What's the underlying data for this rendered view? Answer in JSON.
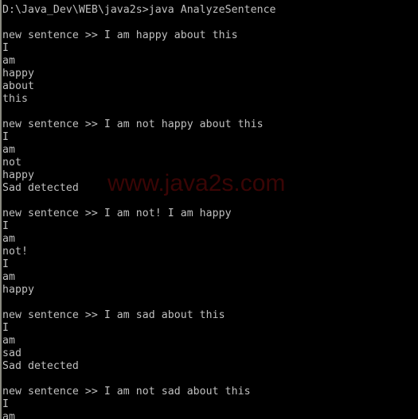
{
  "console": {
    "lines": [
      "D:\\Java_Dev\\WEB\\java2s>java AnalyzeSentence",
      "",
      "new sentence >> I am happy about this",
      "I",
      "am",
      "happy",
      "about",
      "this",
      "",
      "new sentence >> I am not happy about this",
      "I",
      "am",
      "not",
      "happy",
      "Sad detected",
      "",
      "new sentence >> I am not! I am happy",
      "I",
      "am",
      "not!",
      "I",
      "am",
      "happy",
      "",
      "new sentence >> I am sad about this",
      "I",
      "am",
      "sad",
      "Sad detected",
      "",
      "new sentence >> I am not sad about this",
      "I",
      "am"
    ],
    "watermark": "www.java2s.com"
  }
}
